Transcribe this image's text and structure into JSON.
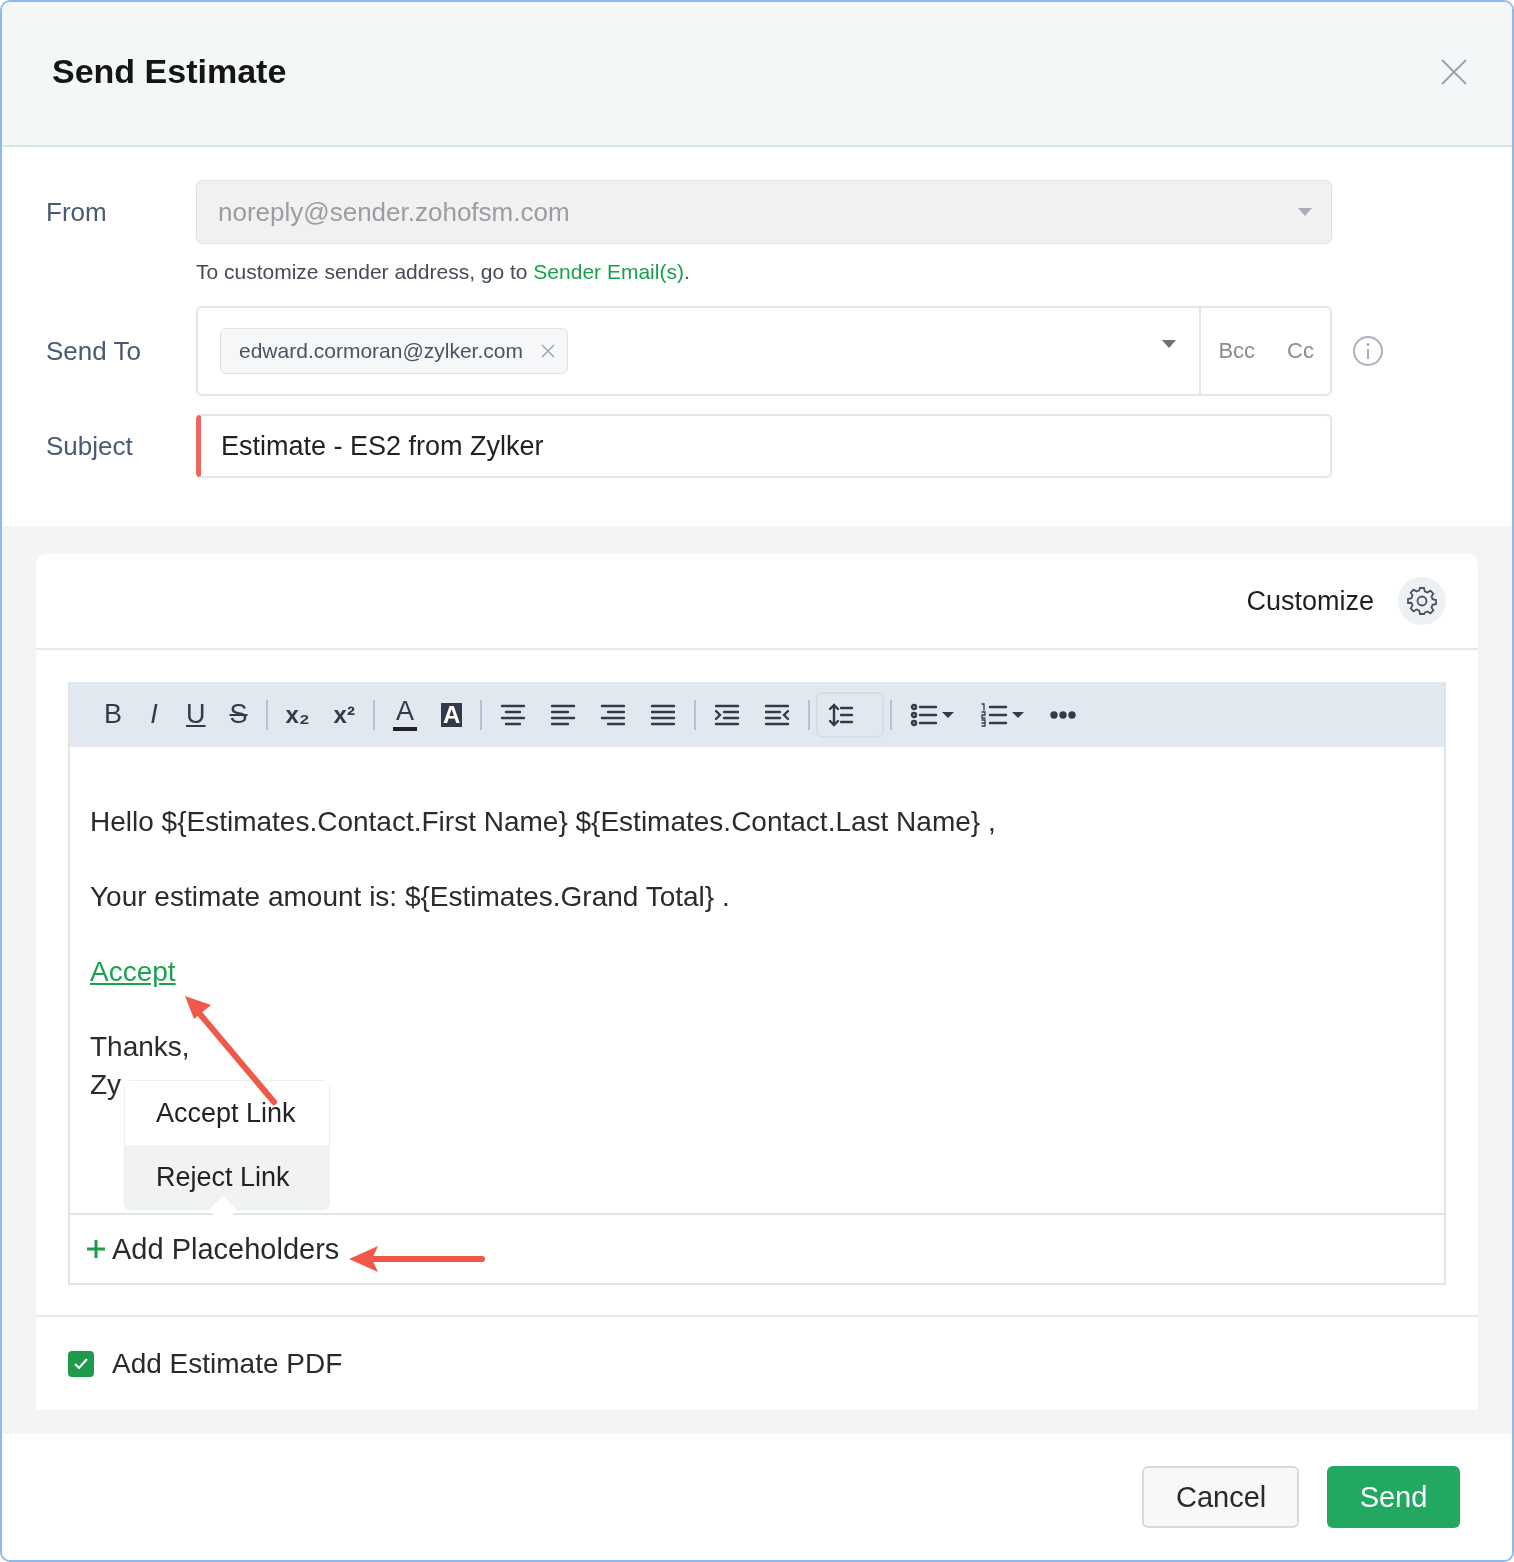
{
  "dialog": {
    "title": "Send Estimate"
  },
  "form": {
    "from": {
      "label": "From",
      "value": "noreply@sender.zohofsm.com",
      "disabled": true
    },
    "hint": {
      "text": "To customize sender address, go to ",
      "link": "Sender Email(s)",
      "end": "."
    },
    "send_to": {
      "label": "Send To",
      "recipients": [
        "edward.cormoran@zylker.com"
      ],
      "bcc": "Bcc",
      "cc": "Cc"
    },
    "subject": {
      "label": "Subject",
      "value": "Estimate - ES2 from Zylker",
      "invalid": true
    }
  },
  "editor": {
    "customize": "Customize",
    "toolbar": [
      {
        "kind": "bold",
        "label": "B",
        "selected": false
      },
      {
        "kind": "italic",
        "label": "I",
        "selected": false
      },
      {
        "kind": "underline",
        "label": "U",
        "selected": false
      },
      {
        "kind": "strike",
        "label": "S",
        "selected": false
      },
      {
        "kind": "separator"
      },
      {
        "kind": "subscript",
        "label": "x₂",
        "selected": false
      },
      {
        "kind": "superscript",
        "label": "x²",
        "selected": false
      },
      {
        "kind": "separator"
      },
      {
        "kind": "font-color",
        "label": "A",
        "selected": false
      },
      {
        "kind": "highlight",
        "label": "A",
        "selected": false
      },
      {
        "kind": "separator"
      },
      {
        "kind": "align-center",
        "selected": false
      },
      {
        "kind": "align-left",
        "selected": false
      },
      {
        "kind": "align-right",
        "selected": false
      },
      {
        "kind": "justify",
        "selected": false
      },
      {
        "kind": "separator"
      },
      {
        "kind": "indent",
        "selected": false
      },
      {
        "kind": "outdent",
        "selected": false
      },
      {
        "kind": "separator"
      },
      {
        "kind": "line-height",
        "selected": true
      },
      {
        "kind": "separator"
      },
      {
        "kind": "bullet-list",
        "selected": false
      },
      {
        "kind": "numbered-list",
        "selected": false
      },
      {
        "kind": "more",
        "selected": false
      }
    ],
    "body": [
      {
        "kind": "text",
        "text": "Hello ${Estimates.Contact.First Name} ${Estimates.Contact.Last Name} ,"
      },
      {
        "kind": "blank"
      },
      {
        "kind": "text",
        "text": "Your estimate amount is: ${Estimates.Grand Total} ."
      },
      {
        "kind": "blank"
      },
      {
        "kind": "link",
        "text": "Accept"
      },
      {
        "kind": "blank"
      },
      {
        "kind": "text",
        "text": "Thanks,"
      },
      {
        "kind": "text",
        "text": "Zy"
      }
    ],
    "popup": [
      {
        "label": "Accept Link",
        "selected": false
      },
      {
        "label": "Reject Link",
        "selected": true
      }
    ],
    "add_placeholders": "Add Placeholders"
  },
  "attach": {
    "label": "Add Estimate PDF",
    "checked": true
  },
  "buttons": [
    {
      "kind": "secondary",
      "label": "Cancel"
    },
    {
      "kind": "primary",
      "label": "Send"
    }
  ],
  "annotations": [
    {
      "kind": "diagonal-arrow"
    },
    {
      "kind": "horizontal-arrow"
    }
  ]
}
